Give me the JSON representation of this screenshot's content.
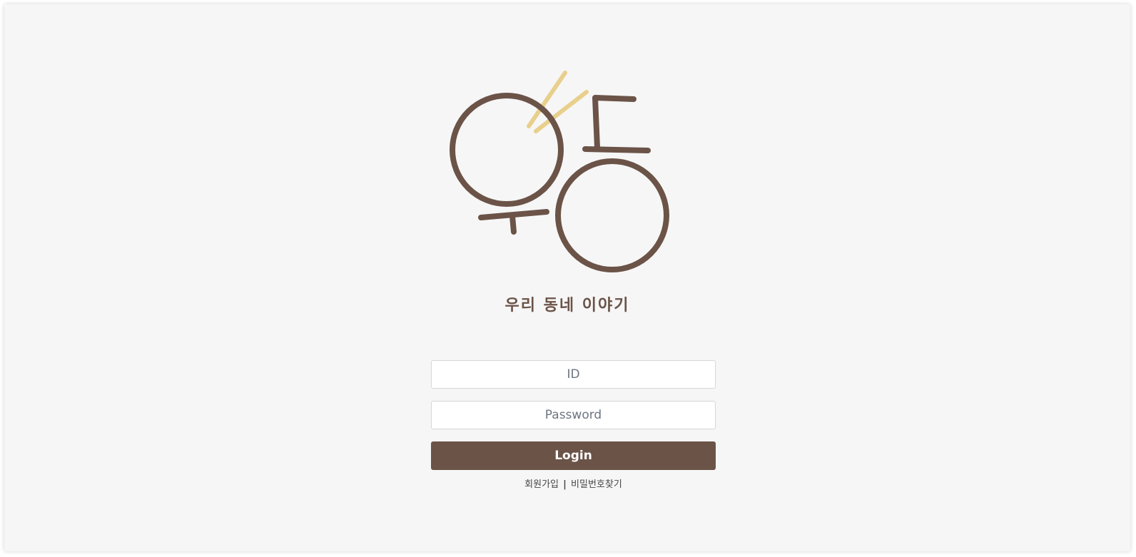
{
  "brand": {
    "tagline": "우리 동네 이야기",
    "logo_alt": "우동",
    "colors": {
      "primary": "#6b5348",
      "accent": "#e8cf8b",
      "background": "#f6f6f6"
    }
  },
  "login_form": {
    "id_placeholder": "ID",
    "password_placeholder": "Password",
    "login_label": "Login"
  },
  "links": {
    "signup_label": "회원가입",
    "separator": "|",
    "find_password_label": "비밀번호찾기"
  }
}
